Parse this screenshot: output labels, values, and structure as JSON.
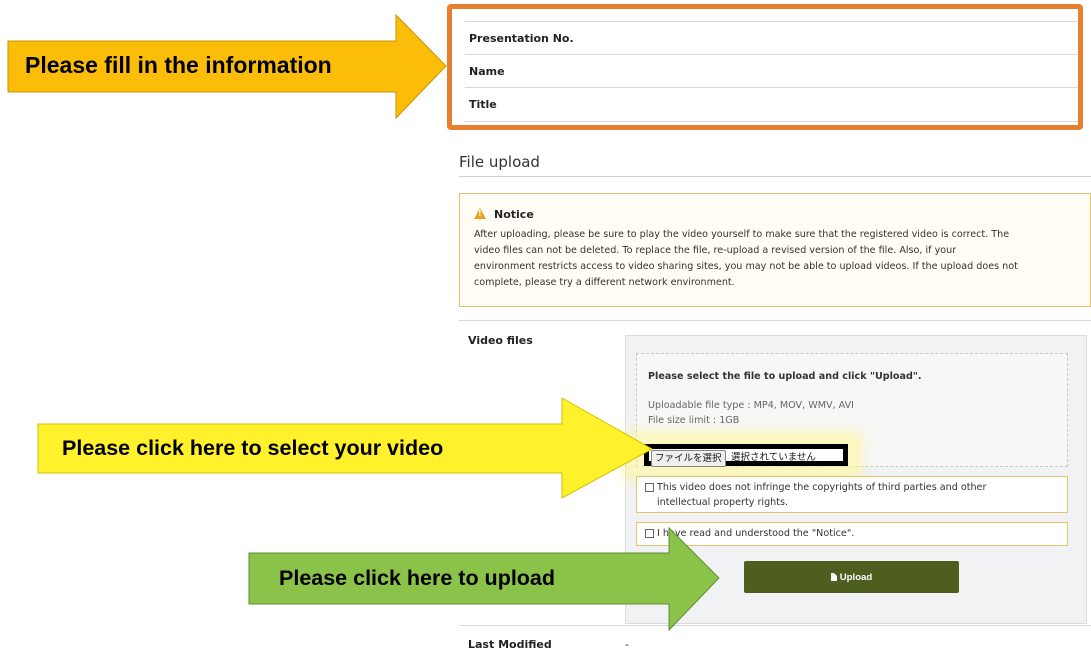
{
  "info_table": {
    "rows": [
      "Presentation No.",
      "Name",
      "Title"
    ]
  },
  "file_upload": {
    "title": "File upload",
    "notice": {
      "heading": "Notice",
      "icon": "warning-triangle-icon",
      "lines": [
        "After uploading, please be sure to play the video yourself to make sure that the registered video is correct. The",
        "video files can not be deleted. To replace the file, re-upload a revised version of the file. Also, if your",
        "environment restricts access to video sharing sites, you may not be able to upload videos. If the upload does not",
        "complete, please try a different network environment."
      ]
    },
    "video_files": {
      "label": "Video files",
      "instruction": "Please select the file to upload and click \"Upload\".",
      "types": "Uploadable file type : MP4, MOV, WMV, AVI",
      "limit": "File size limit : 1GB",
      "choose_button": "ファイルを選択",
      "no_file_text": "選択されていません",
      "checkbox1_line1": "This video does not infringe the copyrights of third parties and other",
      "checkbox1_line2": "intellectual property rights.",
      "checkbox2": "I have read and understood the \"Notice\".",
      "upload_button": "Upload"
    },
    "last_modified": {
      "label": "Last Modified",
      "value": "-"
    }
  },
  "annotations": {
    "fill_info": "Please fill in the information",
    "select_video": "Please click here to select your video",
    "upload": "Please click here to upload"
  },
  "colors": {
    "frame_orange": "#e87e2f",
    "arrow_orange": "#fbbd08",
    "arrow_yellow": "#fff12b",
    "arrow_green": "#8bc34a",
    "upload_button": "#4d5e1f",
    "notice_border": "#e6c26a"
  }
}
